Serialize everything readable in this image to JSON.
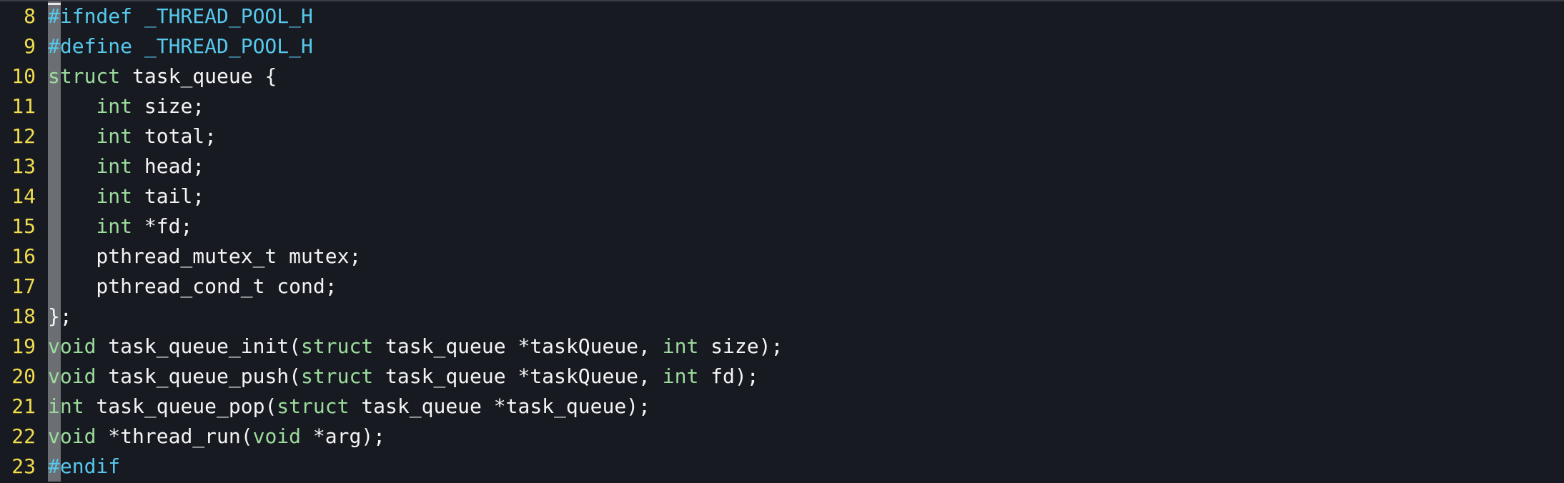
{
  "editor": {
    "lines": [
      {
        "num": "8",
        "tokens": [
          {
            "t": "#ifndef _THREAD_POOL_H",
            "c": "pp"
          }
        ]
      },
      {
        "num": "9",
        "tokens": [
          {
            "t": "#define _THREAD_POOL_H",
            "c": "pp"
          }
        ]
      },
      {
        "num": "10",
        "tokens": [
          {
            "t": "struct",
            "c": "kw"
          },
          {
            "t": " task_queue {",
            "c": "tx"
          }
        ]
      },
      {
        "num": "11",
        "tokens": [
          {
            "t": "    ",
            "c": "tx"
          },
          {
            "t": "int",
            "c": "kw"
          },
          {
            "t": " size;",
            "c": "tx"
          }
        ]
      },
      {
        "num": "12",
        "tokens": [
          {
            "t": "    ",
            "c": "tx"
          },
          {
            "t": "int",
            "c": "kw"
          },
          {
            "t": " total;",
            "c": "tx"
          }
        ]
      },
      {
        "num": "13",
        "tokens": [
          {
            "t": "    ",
            "c": "tx"
          },
          {
            "t": "int",
            "c": "kw"
          },
          {
            "t": " head;",
            "c": "tx"
          }
        ]
      },
      {
        "num": "14",
        "tokens": [
          {
            "t": "    ",
            "c": "tx"
          },
          {
            "t": "int",
            "c": "kw"
          },
          {
            "t": " tail;",
            "c": "tx"
          }
        ]
      },
      {
        "num": "15",
        "tokens": [
          {
            "t": "    ",
            "c": "tx"
          },
          {
            "t": "int",
            "c": "kw"
          },
          {
            "t": " *fd;",
            "c": "tx"
          }
        ]
      },
      {
        "num": "16",
        "tokens": [
          {
            "t": "    pthread_mutex_t mutex;",
            "c": "tx"
          }
        ]
      },
      {
        "num": "17",
        "tokens": [
          {
            "t": "    pthread_cond_t cond;",
            "c": "tx"
          }
        ]
      },
      {
        "num": "18",
        "tokens": [
          {
            "t": "};",
            "c": "tx"
          }
        ]
      },
      {
        "num": "19",
        "tokens": [
          {
            "t": "void",
            "c": "kw"
          },
          {
            "t": " task_queue_init(",
            "c": "tx"
          },
          {
            "t": "struct",
            "c": "kw"
          },
          {
            "t": " task_queue *taskQueue, ",
            "c": "tx"
          },
          {
            "t": "int",
            "c": "kw"
          },
          {
            "t": " size);",
            "c": "tx"
          }
        ]
      },
      {
        "num": "20",
        "tokens": [
          {
            "t": "void",
            "c": "kw"
          },
          {
            "t": " task_queue_push(",
            "c": "tx"
          },
          {
            "t": "struct",
            "c": "kw"
          },
          {
            "t": " task_queue *taskQueue, ",
            "c": "tx"
          },
          {
            "t": "int",
            "c": "kw"
          },
          {
            "t": " fd);",
            "c": "tx"
          }
        ]
      },
      {
        "num": "21",
        "tokens": [
          {
            "t": "int",
            "c": "kw"
          },
          {
            "t": " task_queue_pop(",
            "c": "tx"
          },
          {
            "t": "struct",
            "c": "kw"
          },
          {
            "t": " task_queue *task_queue);",
            "c": "tx"
          }
        ]
      },
      {
        "num": "22",
        "tokens": [
          {
            "t": "void",
            "c": "kw"
          },
          {
            "t": " *thread_run(",
            "c": "tx"
          },
          {
            "t": "void",
            "c": "kw"
          },
          {
            "t": " *arg);",
            "c": "tx"
          }
        ]
      },
      {
        "num": "23",
        "tokens": [
          {
            "t": "#endif",
            "c": "pp"
          }
        ]
      }
    ]
  },
  "colors": {
    "background": "#171a21",
    "line_number": "#f0dc4e",
    "keyword": "#9cdc9c",
    "preprocessor": "#56c8ec",
    "text": "#f4f4f4",
    "sign_column": "#6b6e73"
  }
}
